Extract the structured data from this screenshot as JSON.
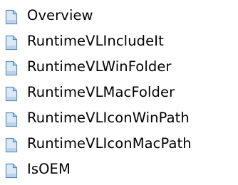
{
  "topics": [
    {
      "label": "Overview",
      "icon": "document-page-icon"
    },
    {
      "label": "RuntimeVLIncludeIt",
      "icon": "document-page-icon"
    },
    {
      "label": "RuntimeVLWinFolder",
      "icon": "document-page-icon"
    },
    {
      "label": "RuntimeVLMacFolder",
      "icon": "document-page-icon"
    },
    {
      "label": "RuntimeVLIconWinPath",
      "icon": "document-page-icon"
    },
    {
      "label": "RuntimeVLIconMacPath",
      "icon": "document-page-icon"
    },
    {
      "label": "IsOEM",
      "icon": "document-page-icon"
    }
  ],
  "colors": {
    "icon_fill": "#dbe9f7",
    "icon_border": "#5a8cc0",
    "icon_fold": "#aecbe8",
    "text": "#000000"
  }
}
